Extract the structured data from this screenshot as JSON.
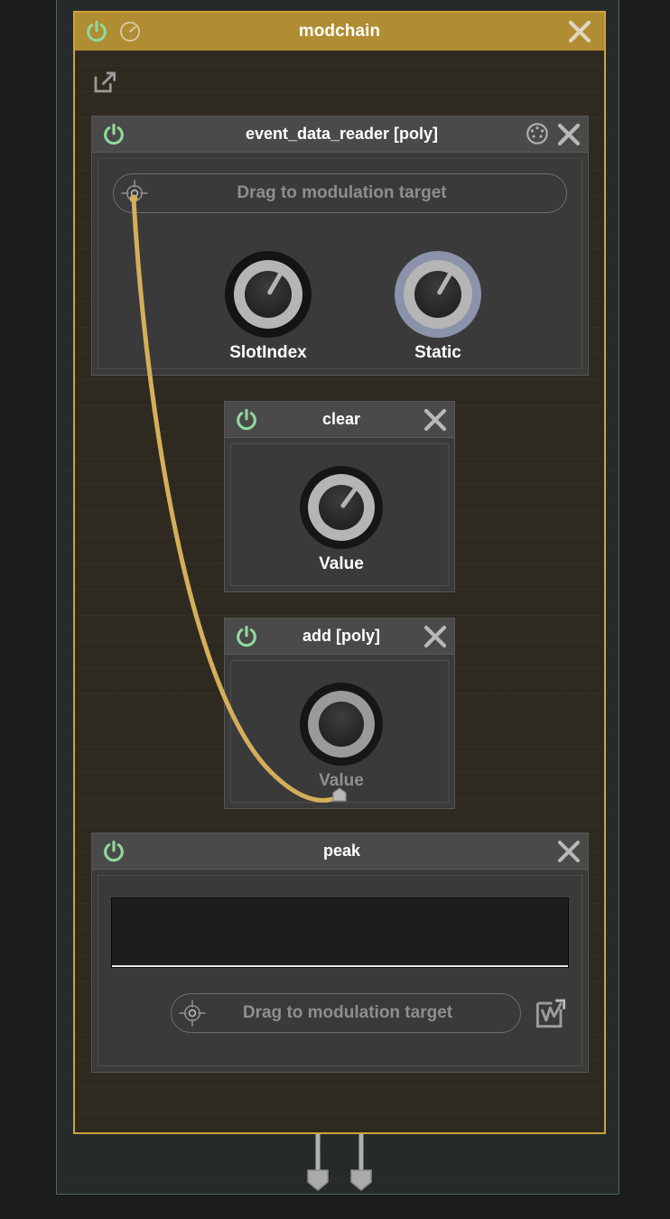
{
  "window": {
    "title": "modchain",
    "accent_gold": "#cfa23c",
    "header_bg": "#b08c32",
    "outer_border": "#4c6566",
    "power_green": "#8fd99a",
    "cable_gold": "#d4ae5a",
    "cable_gray": "#b0b0b0"
  },
  "chain_header": {
    "power_icon": "power-icon",
    "dial_icon": "knob-dial-icon",
    "close_icon": "close-icon"
  },
  "canvas": {
    "expand_icon": "external-link-icon"
  },
  "modules": [
    {
      "id": "event_data_reader",
      "title": "event_data_reader [poly]",
      "power_icon": "power-icon",
      "midi_icon": "midi-din-icon",
      "close_icon": "close-icon",
      "mod_target": {
        "label": "Drag to modulation target",
        "icon": "crosshair-icon"
      },
      "knobs": [
        {
          "label": "SlotIndex",
          "ring_color": "#141414",
          "value_pct": 12
        },
        {
          "label": "Static",
          "ring_color": "#8b93ab",
          "value_pct": 12
        }
      ]
    },
    {
      "id": "clear",
      "title": "clear",
      "power_icon": "power-icon",
      "close_icon": "close-icon",
      "knobs": [
        {
          "label": "Value",
          "ring_color": "#161616",
          "value_pct": 8,
          "label_dim": false
        }
      ]
    },
    {
      "id": "add",
      "title": "add [poly]",
      "power_icon": "power-icon",
      "close_icon": "close-icon",
      "knobs": [
        {
          "label": "Value",
          "ring_color": "#161616",
          "value_pct": 0,
          "label_dim": true
        }
      ]
    },
    {
      "id": "peak",
      "title": "peak",
      "power_icon": "power-icon",
      "close_icon": "close-icon",
      "display": {
        "name": "peak-display"
      },
      "mod_target": {
        "label": "Drag to modulation target",
        "icon": "crosshair-icon"
      },
      "scope_icon": "waveform-expand-icon"
    }
  ],
  "connections": {
    "top_input": {
      "icon": "cable-plug-up"
    },
    "bottom_outputs": [
      {
        "icon": "cable-plug-down"
      },
      {
        "icon": "cable-plug-down"
      }
    ],
    "modulation_cable": {
      "from": "event_data_reader.mod-source",
      "to": "add.value-mod-point",
      "color": "#d4ae5a"
    }
  }
}
